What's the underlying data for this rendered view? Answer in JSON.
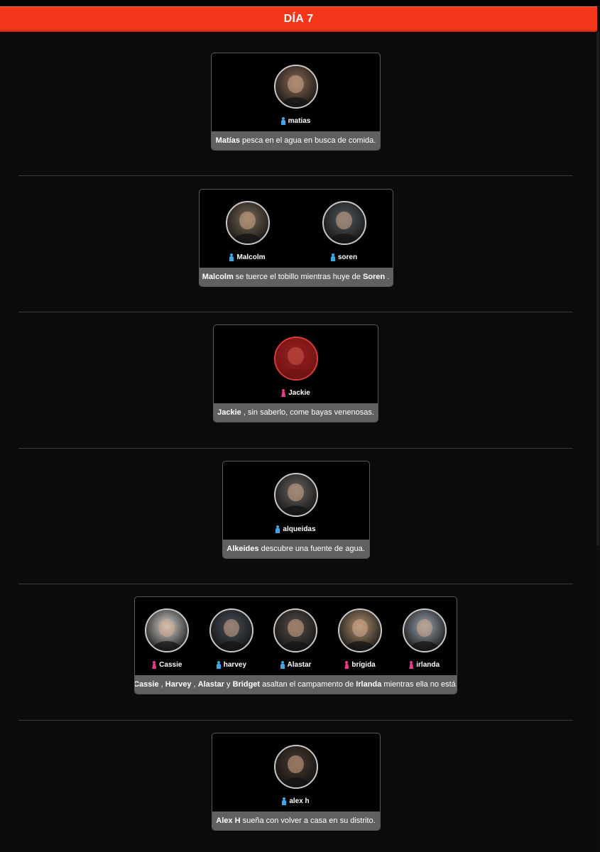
{
  "header": {
    "title": "DÍA 7"
  },
  "events": [
    {
      "people": [
        {
          "name": "matias",
          "gender": "male",
          "tone": "#8a6a55",
          "dead": false
        }
      ],
      "caption": [
        {
          "t": "Matías",
          "b": true
        },
        {
          "t": " pesca en el agua en busca de comida.",
          "b": false
        }
      ]
    },
    {
      "people": [
        {
          "name": "Malcolm",
          "gender": "male",
          "tone": "#7a6a55",
          "dead": false
        },
        {
          "name": "soren",
          "gender": "male",
          "tone": "#555a5e",
          "dead": false
        }
      ],
      "caption": [
        {
          "t": "Malcolm",
          "b": true
        },
        {
          "t": " se tuerce el tobillo mientras huye de ",
          "b": false
        },
        {
          "t": "Soren",
          "b": true
        },
        {
          "t": " .",
          "b": false
        }
      ]
    },
    {
      "people": [
        {
          "name": "Jackie",
          "gender": "female",
          "tone": "#6a3030",
          "dead": true
        }
      ],
      "caption": [
        {
          "t": "Jackie",
          "b": true
        },
        {
          "t": " , sin saberlo, come bayas venenosas.",
          "b": false
        }
      ]
    },
    {
      "people": [
        {
          "name": "alqueidas",
          "gender": "male",
          "tone": "#6a6460",
          "dead": false
        }
      ],
      "caption": [
        {
          "t": "Alkeides",
          "b": true
        },
        {
          "t": " descubre una fuente de agua.",
          "b": false
        }
      ]
    },
    {
      "people": [
        {
          "name": "Cassie",
          "gender": "female",
          "tone": "#d8d4d0",
          "dead": false
        },
        {
          "name": "harvey",
          "gender": "male",
          "tone": "#4a5058",
          "dead": false
        },
        {
          "name": "Alastar",
          "gender": "male",
          "tone": "#5a5048",
          "dead": false
        },
        {
          "name": "brígida",
          "gender": "female",
          "tone": "#b09070",
          "dead": false
        },
        {
          "name": "irlanda",
          "gender": "female",
          "tone": "#9aa4b0",
          "dead": false
        }
      ],
      "caption": [
        {
          "t": "Cassie",
          "b": true
        },
        {
          "t": " , ",
          "b": false
        },
        {
          "t": "Harvey",
          "b": true
        },
        {
          "t": " , ",
          "b": false
        },
        {
          "t": "Alastar",
          "b": true
        },
        {
          "t": " y ",
          "b": false
        },
        {
          "t": "Bridget",
          "b": true
        },
        {
          "t": " asaltan el campamento de ",
          "b": false
        },
        {
          "t": "Irlanda",
          "b": true
        },
        {
          "t": " mientras ella no está.",
          "b": false
        }
      ]
    },
    {
      "people": [
        {
          "name": "alex h",
          "gender": "male",
          "tone": "#4a3a30",
          "dead": false
        }
      ],
      "caption": [
        {
          "t": "Alex H",
          "b": true
        },
        {
          "t": " sueña con volver a casa en su distrito.",
          "b": false
        }
      ]
    }
  ]
}
